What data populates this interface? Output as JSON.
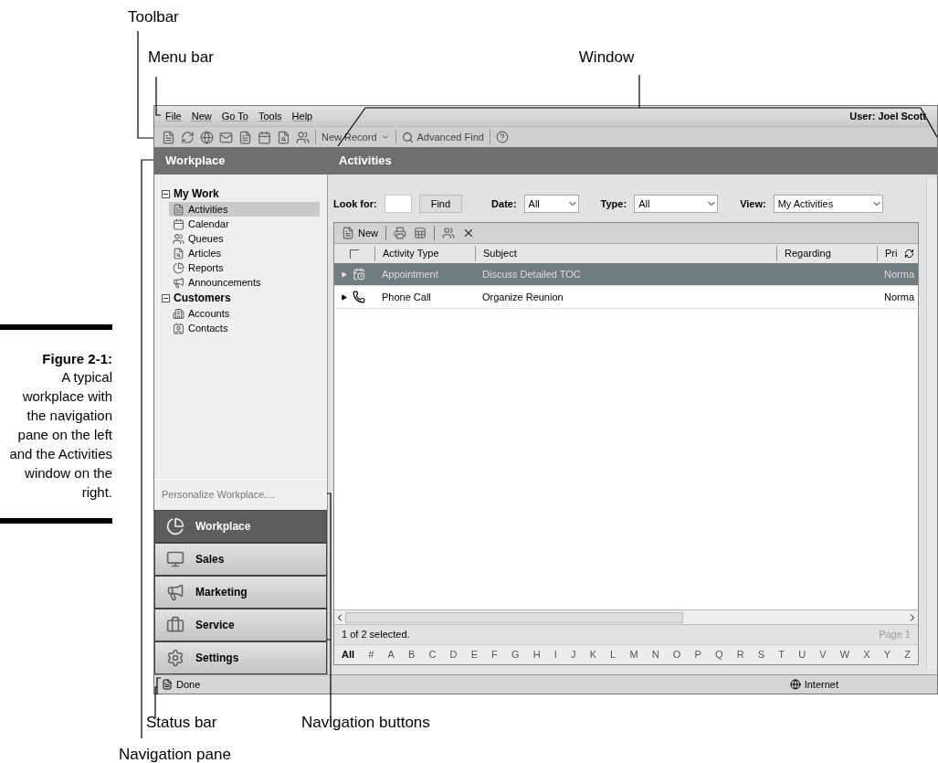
{
  "callouts_top": [
    {
      "label": "Toolbar"
    },
    {
      "label": "Menu bar"
    },
    {
      "label": "Window"
    }
  ],
  "figure": {
    "label": "Figure 2-1:",
    "caption": "A typical workplace with the navigation pane on the left and the Activities window on the right."
  },
  "menu_bar": {
    "items": [
      "File",
      "New",
      "Go To",
      "Tools",
      "Help"
    ],
    "user": "User: Joel Scott"
  },
  "toolbar": {
    "new_record": "New Record",
    "advanced_find": "Advanced Find"
  },
  "header": {
    "pane_title": "Workplace",
    "page_title": "Activities"
  },
  "nav_tree": [
    {
      "label": "My Work",
      "expanded": true,
      "children": [
        {
          "label": "Activities",
          "selected": true
        },
        {
          "label": "Calendar",
          "selected": false
        },
        {
          "label": "Queues",
          "selected": false
        },
        {
          "label": "Articles",
          "selected": false
        },
        {
          "label": "Reports",
          "selected": false
        },
        {
          "label": "Announcements",
          "selected": false
        }
      ]
    },
    {
      "label": "Customers",
      "expanded": true,
      "children": [
        {
          "label": "Accounts",
          "selected": false
        },
        {
          "label": "Contacts",
          "selected": false
        }
      ]
    }
  ],
  "personalize": "Personalize Workplace....",
  "nav_buttons": [
    {
      "label": "Workplace",
      "selected": true
    },
    {
      "label": "Sales",
      "selected": false
    },
    {
      "label": "Marketing",
      "selected": false
    },
    {
      "label": "Service",
      "selected": false
    },
    {
      "label": "Settings",
      "selected": false
    }
  ],
  "filters": {
    "look_for": "Look for:",
    "find": "Find",
    "date_label": "Date:",
    "date": "All",
    "type_label": "Type:",
    "type": "All",
    "view_label": "View:",
    "view": "My Activities"
  },
  "grid": {
    "new": "New",
    "select_all_checked": false,
    "columns": [
      "Activity Type",
      "Subject",
      "Regarding",
      "Pri"
    ],
    "rows": [
      {
        "kind": "appointment",
        "type": "Appointment",
        "subject": "Discuss Detailed TOC",
        "priority": "Norma",
        "selected": true
      },
      {
        "kind": "phone",
        "type": "Phone Call",
        "subject": "Organize Reunion",
        "priority": "Norma",
        "selected": false
      }
    ],
    "status": "1 of 2 selected.",
    "page": "Page 1",
    "letters": [
      "All",
      "#",
      "A",
      "B",
      "C",
      "D",
      "E",
      "F",
      "G",
      "H",
      "I",
      "J",
      "K",
      "L",
      "M",
      "N",
      "O",
      "P",
      "Q",
      "R",
      "S",
      "T",
      "U",
      "V",
      "W",
      "X",
      "Y",
      "Z"
    ]
  },
  "status_bar": {
    "text": "Done",
    "zone": "Internet"
  },
  "callouts_bottom": [
    {
      "label": "Status bar"
    },
    {
      "label": "Navigation buttons"
    },
    {
      "label": "Navigation pane"
    }
  ]
}
